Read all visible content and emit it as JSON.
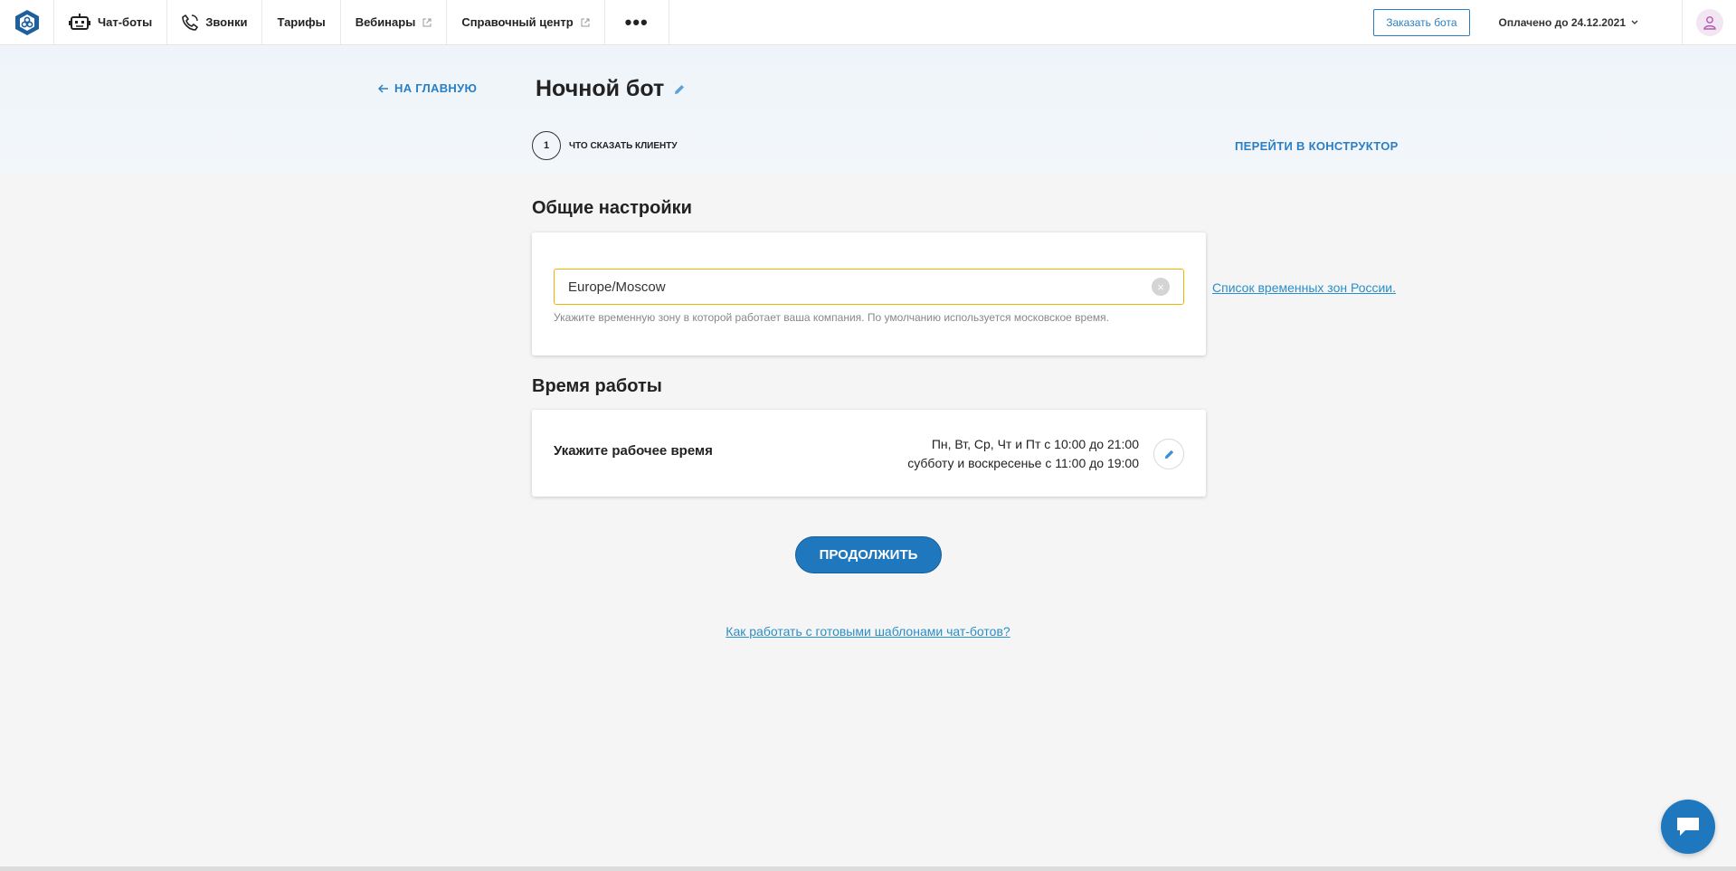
{
  "nav": {
    "items": [
      {
        "label": "Чат-боты",
        "icon": "robot-icon"
      },
      {
        "label": "Звонки",
        "icon": "phone-icon"
      },
      {
        "label": "Тарифы"
      },
      {
        "label": "Вебинары",
        "icon": "external-link-icon"
      },
      {
        "label": "Справочный центр",
        "icon": "external-link-icon"
      }
    ],
    "more_label": "•••",
    "order_button": "Заказать бота",
    "paid_until": "Оплачено до 24.12.2021"
  },
  "header": {
    "back_label": "НА ГЛАВНУЮ",
    "title": "Ночной бот",
    "step_number": "1",
    "step_label": "ЧТО СКАЗАТЬ КЛИЕНТУ",
    "constructor_link": "ПЕРЕЙТИ В КОНСТРУКТОР"
  },
  "general": {
    "title": "Общие настройки",
    "timezone_value": "Europe/Moscow",
    "timezone_hint": "Укажите временную зону в которой работает ваша компания. По умолчанию используется московское время.",
    "timezone_list_link": "Список временных зон России."
  },
  "hours": {
    "title": "Время работы",
    "label": "Укажите рабочее время",
    "line1": "Пн, Вт, Ср, Чт и Пт с 10:00 до 21:00",
    "line2": "субботу и воскресенье с 11:00 до 19:00"
  },
  "actions": {
    "continue": "ПРОДОЛЖИТЬ",
    "templates_link": "Как работать с готовыми шаблонами чат-ботов?"
  },
  "colors": {
    "accent": "#1f78be",
    "link": "#2a8fc9",
    "focus_border": "#f0b400"
  }
}
